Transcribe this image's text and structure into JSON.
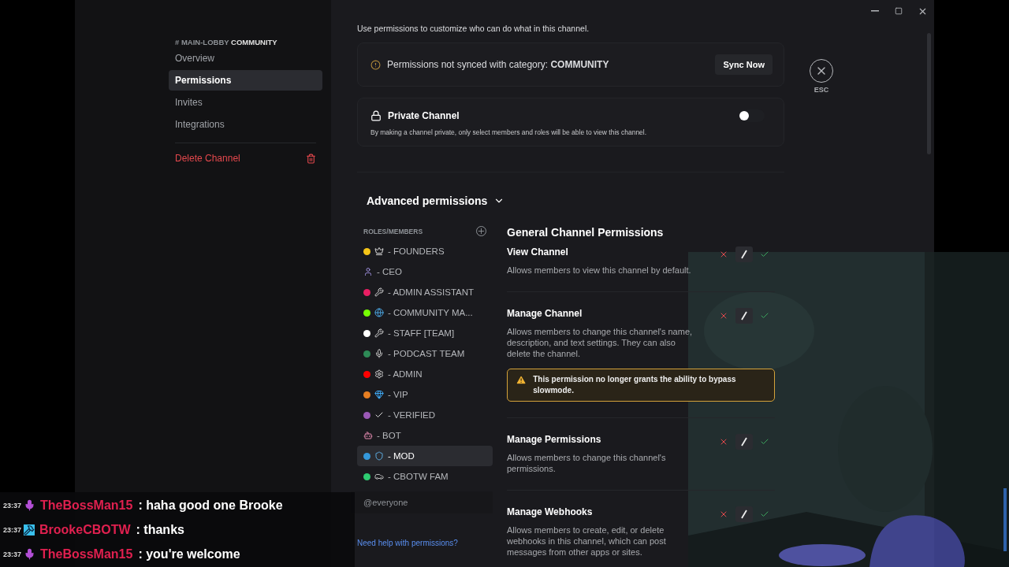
{
  "window_controls": [
    {
      "kind": "minimize"
    },
    {
      "kind": "maximize"
    },
    {
      "kind": "close"
    }
  ],
  "sidebar": {
    "channel": "# MAIN-LOBBY",
    "category": "COMMUNITY",
    "items": [
      {
        "label": "Overview",
        "selected": false
      },
      {
        "label": "Permissions",
        "selected": true
      },
      {
        "label": "Invites",
        "selected": false
      },
      {
        "label": "Integrations",
        "selected": false
      }
    ],
    "delete": "Delete Channel"
  },
  "intro": "Use permissions to customize who can do what in this channel.",
  "sync_notice": {
    "text": "Permissions not synced with category: **COMMUNITY**",
    "button": "Sync Now"
  },
  "private_channel": {
    "title": "Private Channel",
    "description": "By making a channel private, only select members and roles will be able to view this channel.",
    "on": false
  },
  "esc": "ESC",
  "advanced": {
    "title": "Advanced permissions",
    "expanded": true
  },
  "roles": {
    "header": "ROLES/MEMBERS",
    "items": [
      {
        "kind": "crown",
        "name": "- FOUNDERS",
        "color": "#f5c518",
        "selected": false
      },
      {
        "kind": "person",
        "name": "- CEO",
        "selected": false
      },
      {
        "kind": "wrench",
        "name": "- ADMIN ASSISTANT",
        "color": "#e91e63",
        "selected": false
      },
      {
        "kind": "globe",
        "name": "- COMMUNITY MA...",
        "color": "#76ff03",
        "selected": false
      },
      {
        "kind": "wrench",
        "name": "- STAFF [TEAM]",
        "color": "#ffffff",
        "selected": false
      },
      {
        "kind": "mic",
        "name": "- PODCAST TEAM",
        "color": "#2e8b57",
        "selected": false
      },
      {
        "kind": "gear",
        "name": "- ADMIN",
        "color": "#ff0000",
        "selected": false
      },
      {
        "kind": "gem",
        "name": "- VIP",
        "color": "#e67e22",
        "selected": false
      },
      {
        "kind": "check",
        "name": "- VERIFIED",
        "color": "#9b59b6",
        "selected": false
      },
      {
        "kind": "robot",
        "name": "- BOT",
        "selected": false
      },
      {
        "kind": "shield",
        "name": "- MOD",
        "color": "#3498db",
        "selected": true
      },
      {
        "kind": "car",
        "name": "- CBOTW FAM",
        "color": "#2ecc71",
        "selected": false
      }
    ],
    "everyone": "@everyone"
  },
  "help_link": "Need help with permissions?",
  "permissions": {
    "title": "General Channel Permissions",
    "items": [
      {
        "name": "View Channel",
        "description": "Allows members to view this channel by default.",
        "denied": false,
        "allowed": false
      },
      {
        "name": "Manage Channel",
        "description": "Allows members to change this channel's name, description, and text settings. They can also delete the channel.",
        "denied": false,
        "allowed": false,
        "warning": "This permission no longer grants the ability to bypass slowmode."
      },
      {
        "name": "Manage Permissions",
        "description": "Allows members to change this channel's permissions.",
        "denied": false,
        "allowed": false
      },
      {
        "name": "Manage Webhooks",
        "description": "Allows members to create, edit, or delete webhooks in this channel, which can post messages from other apps or sites.",
        "denied": false,
        "allowed": false
      }
    ]
  },
  "chat": [
    {
      "time": "23:37",
      "kind": "mic",
      "user": "TheBossMan15",
      "message": ": haha good one Brooke"
    },
    {
      "time": "23:37",
      "kind": "hammer",
      "user": "BrookeCBOTW",
      "message": ": thanks"
    },
    {
      "time": "23:37",
      "kind": "mic",
      "user": "TheBossMan15",
      "message": ": you're welcome"
    }
  ]
}
